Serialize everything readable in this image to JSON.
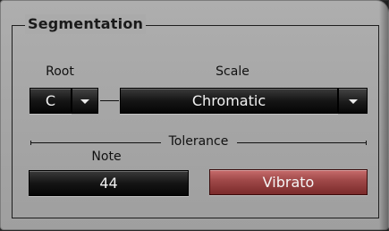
{
  "group": {
    "title": "Segmentation"
  },
  "root": {
    "label": "Root",
    "value": "C"
  },
  "scale": {
    "label": "Scale",
    "value": "Chromatic"
  },
  "tolerance": {
    "label": "Tolerance",
    "note_label": "Note",
    "note_value": "44",
    "vibrato_label": "Vibrato"
  },
  "colors": {
    "panel_bg": "#aaaaaa",
    "field_bg": "#111111",
    "vibrato_bg": "#9a4444",
    "text_light": "#f2f2f2"
  }
}
